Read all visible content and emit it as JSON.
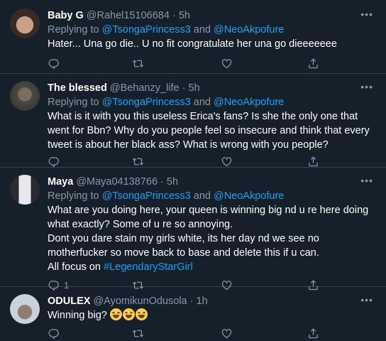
{
  "tweets": [
    {
      "name": "Baby G",
      "handle": "@Rahel15106684",
      "time": "5h",
      "reply_prefix": "Replying to",
      "reply_to_1": "@TsongaPrincess3",
      "reply_and": "and",
      "reply_to_2": "@NeoAkpofure",
      "text": "Hater... Una go die.. U no fit congratulate her una go dieeeeeee",
      "reply_count": "",
      "avatar_colors": [
        "#3a2a25",
        "#c9a08a"
      ]
    },
    {
      "name": "The blessed",
      "handle": "@Behanzy_life",
      "time": "5h",
      "reply_prefix": "Replying to",
      "reply_to_1": "@TsongaPrincess3",
      "reply_and": "and",
      "reply_to_2": "@NeoAkpofure",
      "text": "What is it with you this useless Erica's fans? Is she the only one that went for Bbn? Why do you people feel so insecure and think that every tweet is about her black ass? What is wrong with you people?",
      "reply_count": "",
      "avatar_colors": [
        "#4a4a42",
        "#6b6258"
      ]
    },
    {
      "name": "Maya",
      "handle": "@Maya04138766",
      "time": "5h",
      "reply_prefix": "Replying to",
      "reply_to_1": "@TsongaPrincess3",
      "reply_and": "and",
      "reply_to_2": "@NeoAkpofure",
      "text_lines": [
        "What are you doing here, your queen is winning big nd u re here doing what exactly? Some of u re so annoying.",
        "Dont you dare stain my girls white, its her day nd we see no motherfucker so move back to base and delete this if u can.",
        "All focus on"
      ],
      "hashtag": "#LegendaryStarGirl",
      "reply_count": "1",
      "avatar_colors": [
        "#e8e8ea",
        "#2a2a30"
      ]
    },
    {
      "name": "ODULEX",
      "handle": "@AyomikunOdusola",
      "time": "1h",
      "text": "Winning big?",
      "reply_count": "",
      "avatar_colors": [
        "#c9d2dc",
        "#8f7c74"
      ]
    }
  ],
  "icons": {
    "more": "more-options-icon",
    "reply": "reply-icon",
    "retweet": "retweet-icon",
    "like": "like-icon",
    "share": "share-icon",
    "emoji": "tears-of-joy-emoji"
  },
  "colors": {
    "background": "#15202b",
    "divider": "#38444d",
    "link": "#1da1f2",
    "secondary": "#8899a6"
  }
}
